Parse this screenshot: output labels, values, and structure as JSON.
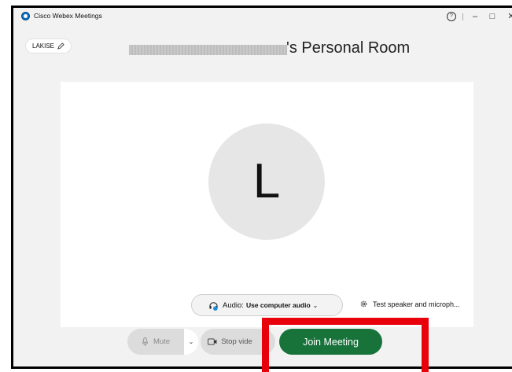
{
  "window": {
    "title": "Cisco Webex Meetings",
    "help_glyph": "?",
    "minimize_glyph": "–",
    "maximize_glyph": "□",
    "close_glyph": "✕"
  },
  "header": {
    "user_name": "LAKISE",
    "room_title": "'s Personal Room"
  },
  "preview": {
    "avatar_initial": "L",
    "audio_prefix": "Audio:",
    "audio_value": "Use computer audio",
    "test_speaker_label": "Test speaker and microph..."
  },
  "controls": {
    "mute_label": "Mute",
    "stop_video_label": "Stop vide",
    "join_label": "Join Meeting"
  },
  "colors": {
    "join_button": "#17733a",
    "highlight_box": "#e8000b",
    "app_icon": "#0e6fbf"
  },
  "icons": [
    "app-logo-icon",
    "help-icon",
    "pencil-icon",
    "headset-icon",
    "gear-icon",
    "microphone-icon",
    "camera-icon",
    "chevron-down-icon"
  ]
}
